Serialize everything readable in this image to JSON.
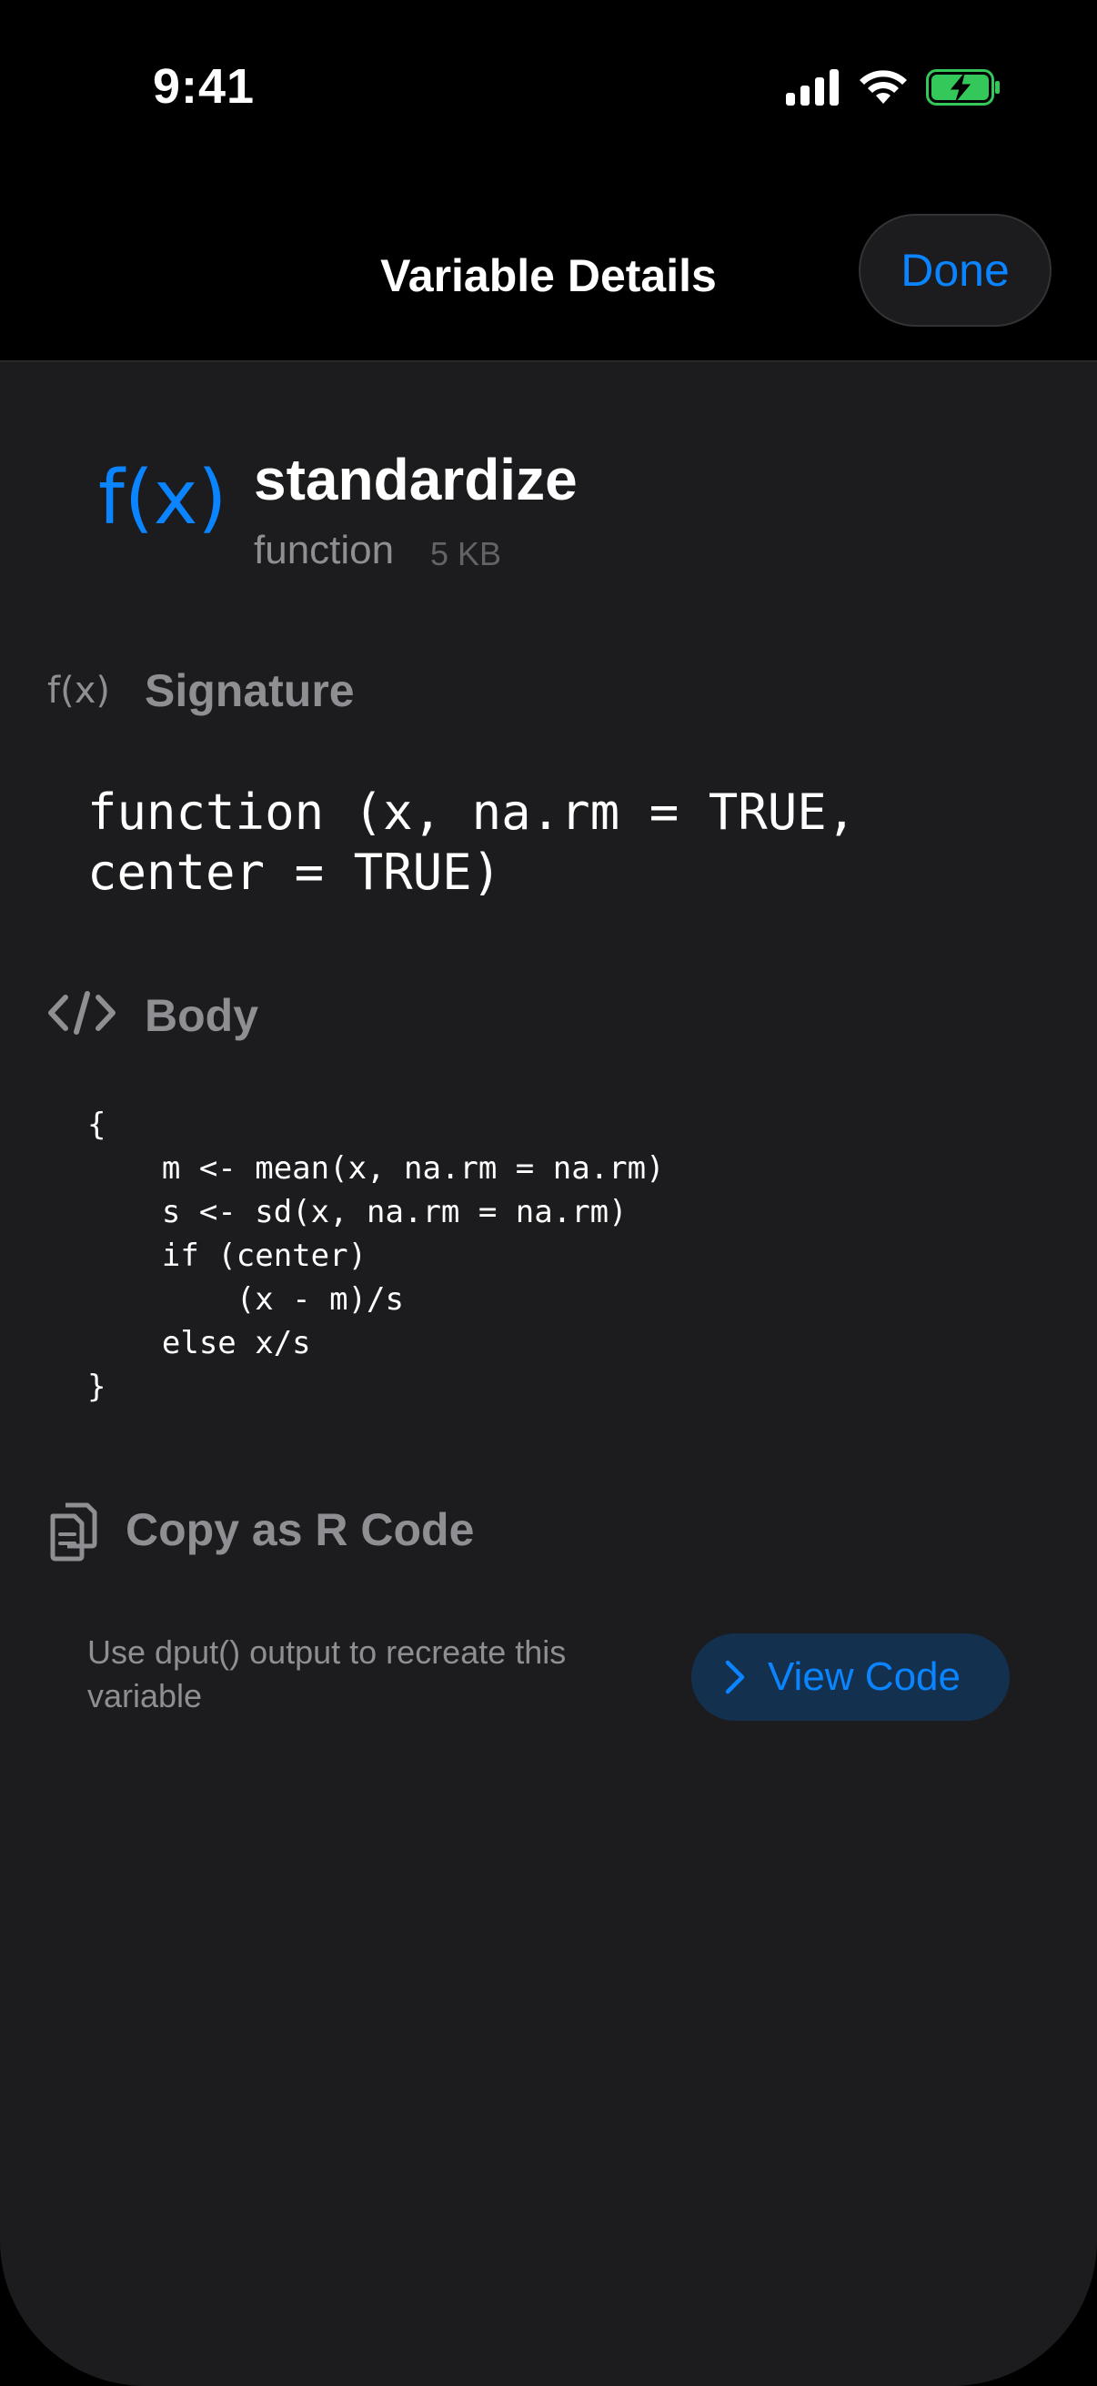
{
  "status_bar": {
    "time": "9:41",
    "icons": [
      "cellular-signal-icon",
      "wifi-icon",
      "battery-charging-icon"
    ]
  },
  "nav": {
    "title": "Variable Details",
    "done_label": "Done"
  },
  "variable": {
    "icon": "function-icon",
    "icon_glyph": "f(x)",
    "name": "standardize",
    "type": "function",
    "size": "5 KB"
  },
  "signature": {
    "title": "Signature",
    "icon": "function-icon",
    "icon_glyph": "f(x)",
    "code": "function (x, na.rm = TRUE,\ncenter = TRUE)"
  },
  "body": {
    "title": "Body",
    "icon": "code-brackets-icon",
    "code": "{\n    m <- mean(x, na.rm = na.rm)\n    s <- sd(x, na.rm = na.rm)\n    if (center)\n        (x - m)/s\n    else x/s\n}"
  },
  "copy": {
    "title": "Copy as R Code",
    "icon": "copy-document-icon",
    "description": "Use dput() output to recreate this variable",
    "button_label": "View Code",
    "button_icon": "chevron-right-icon"
  },
  "colors": {
    "accent": "#0a84ff",
    "background": "#1c1c1e",
    "secondary_text": "#8e8e93",
    "button_fill": "#14304f",
    "battery_green": "#34c759"
  }
}
